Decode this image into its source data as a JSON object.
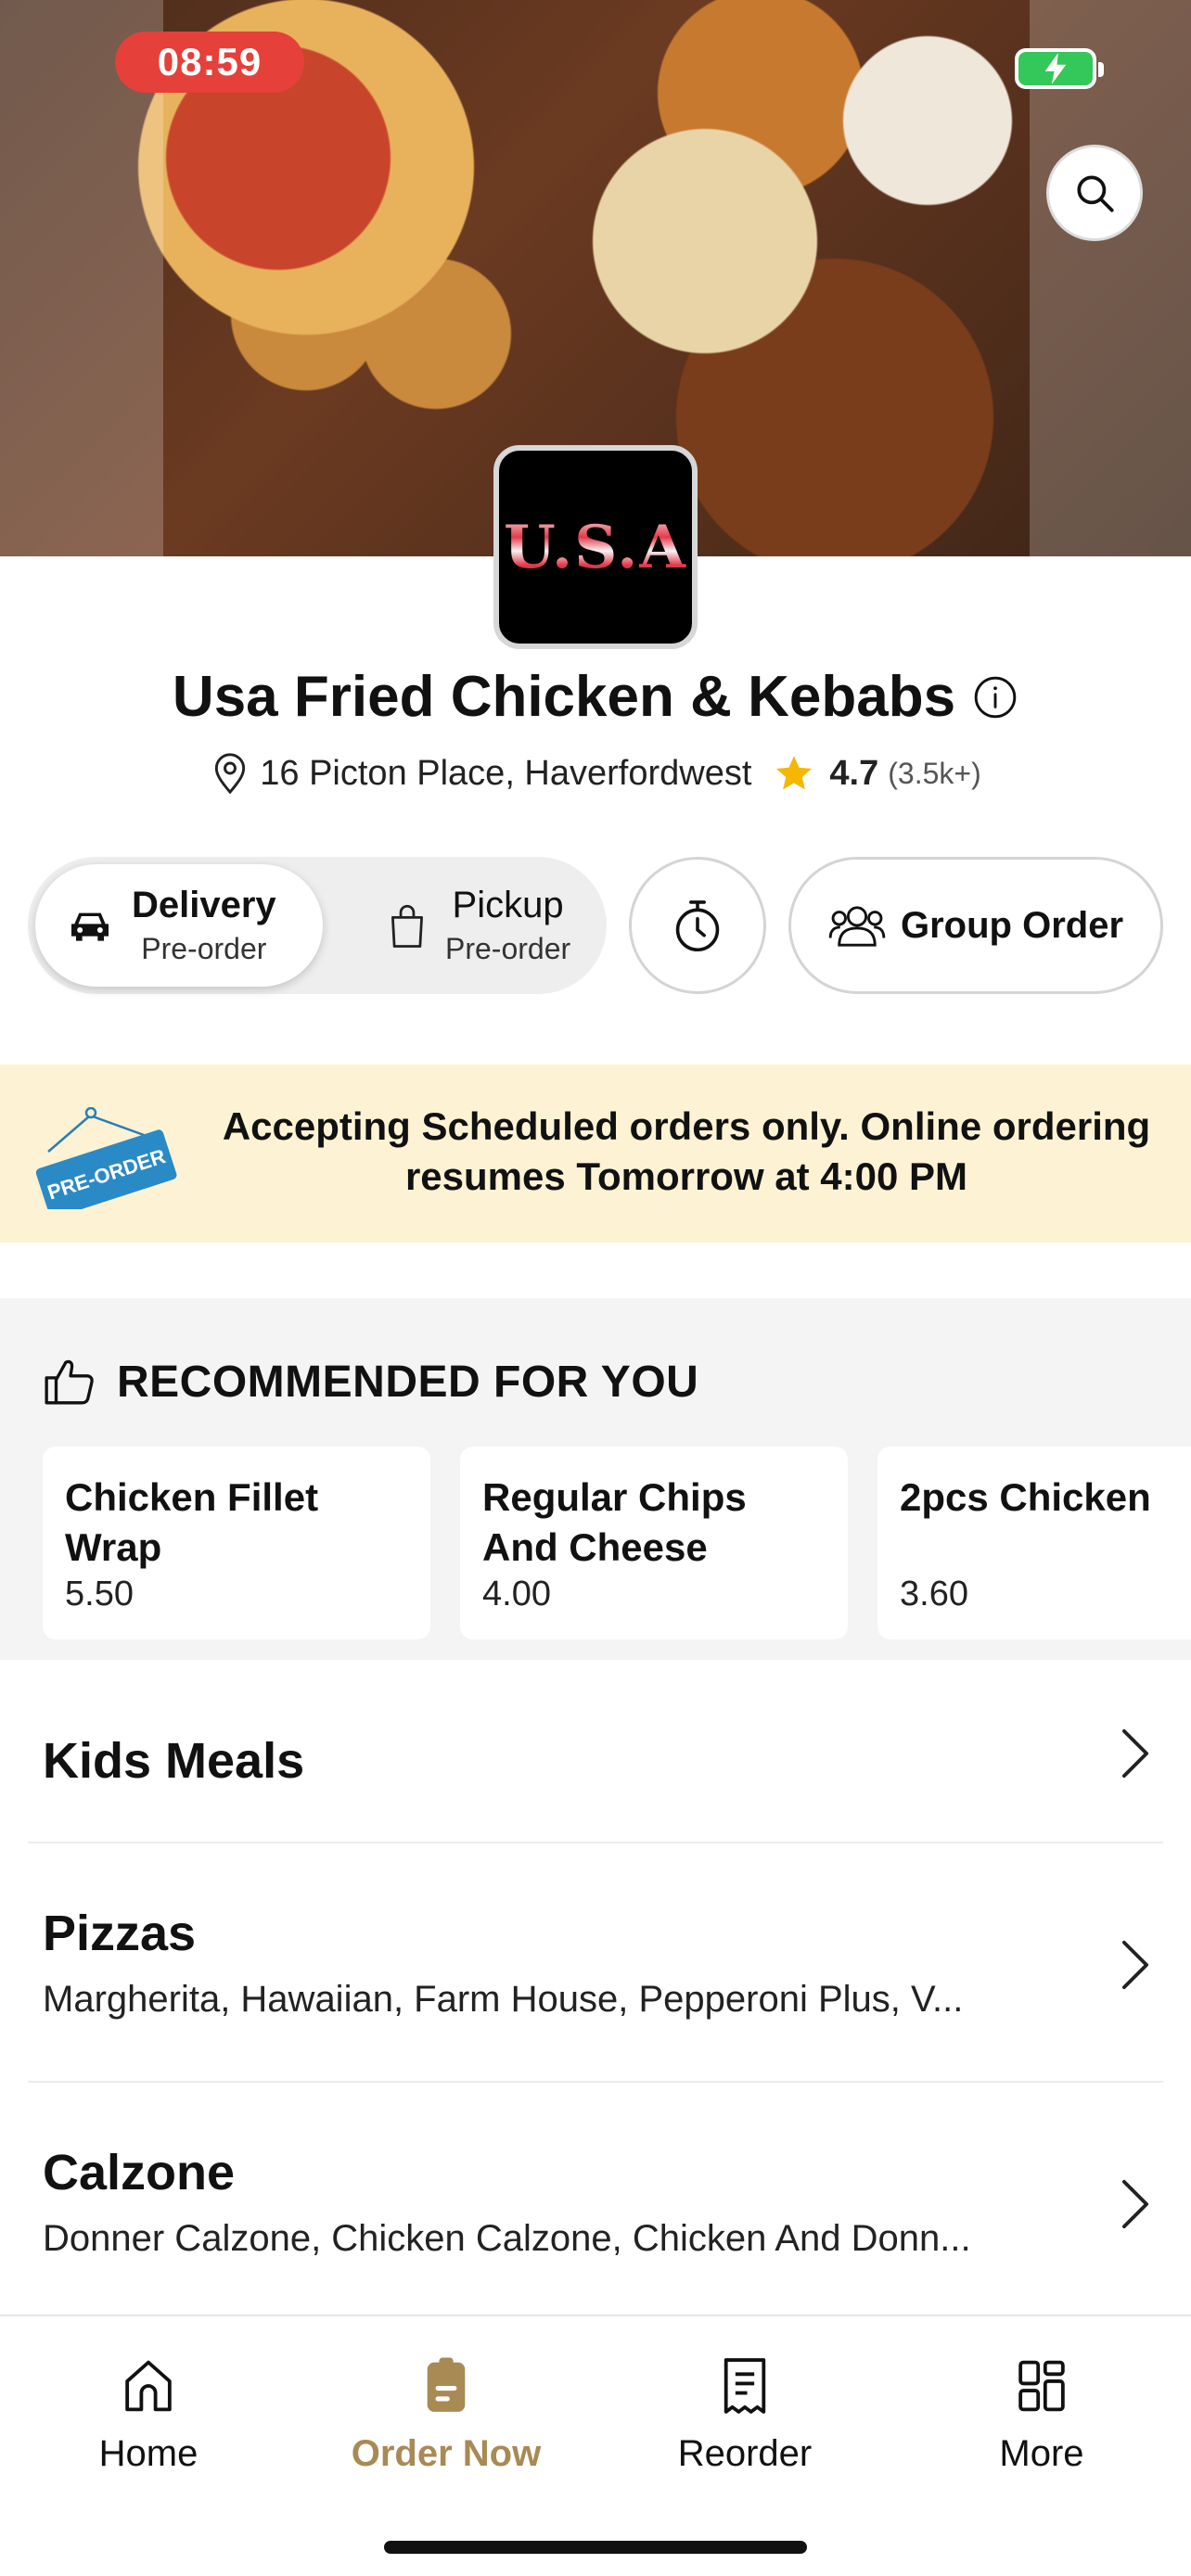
{
  "status": {
    "time": "08:59"
  },
  "restaurant": {
    "logo_text": "U.S.A",
    "name": "Usa Fried Chicken & Kebabs",
    "address": "16 Picton Place, Haverfordwest",
    "rating": "4.7",
    "rating_count": "(3.5k+)"
  },
  "modes": {
    "delivery": {
      "label": "Delivery",
      "sub": "Pre-order",
      "selected": true
    },
    "pickup": {
      "label": "Pickup",
      "sub": "Pre-order",
      "selected": false
    },
    "group_order": "Group Order"
  },
  "banner": {
    "tag": "PRE-ORDER",
    "text": "Accepting Scheduled orders only. Online ordering resumes Tomorrow at 4:00 PM"
  },
  "recommended": {
    "title": "RECOMMENDED FOR YOU",
    "items": [
      {
        "name": "Chicken Fillet Wrap",
        "price": "5.50"
      },
      {
        "name": "Regular Chips And Cheese",
        "price": "4.00"
      },
      {
        "name": "2pcs Chicken",
        "price": "3.60"
      }
    ]
  },
  "categories": [
    {
      "name": "Kids Meals",
      "items": ""
    },
    {
      "name": "Pizzas",
      "items": "Margherita, Hawaiian, Farm House, Pepperoni Plus, V..."
    },
    {
      "name": "Calzone",
      "items": "Donner Calzone, Chicken Calzone, Chicken And Donn..."
    }
  ],
  "tabs": [
    {
      "label": "Home",
      "icon": "home-icon",
      "active": false
    },
    {
      "label": "Order Now",
      "icon": "order-icon",
      "active": true
    },
    {
      "label": "Reorder",
      "icon": "receipt-icon",
      "active": false
    },
    {
      "label": "More",
      "icon": "grid-icon",
      "active": false
    }
  ],
  "colors": {
    "accent": "#a88a55",
    "status_red": "#e5403a",
    "banner_bg": "#fdf3d4",
    "star": "#f5b700"
  }
}
